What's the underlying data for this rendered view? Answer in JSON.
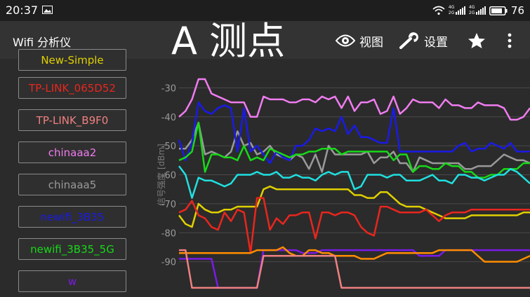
{
  "status_bar": {
    "time": "20:37",
    "signal_label_1": "4G",
    "signal_label_2": "2G",
    "signal_label_3": "4G",
    "signal_label_4": "2G",
    "battery": "76"
  },
  "app_bar": {
    "title": "Wifi 分析仪",
    "overlay_title": "A 测点",
    "view_label": "视图",
    "settings_label": "设置"
  },
  "sidebar": {
    "items": [
      {
        "label": "New-Simple",
        "color": "#e0d000"
      },
      {
        "label": "TP-LINK_065D52",
        "color": "#e8261e"
      },
      {
        "label": "TP-LINK_B9F0",
        "color": "#f08080"
      },
      {
        "label": "chinaaa2",
        "color": "#f07cf0"
      },
      {
        "label": "chinaaa5",
        "color": "#9a9a9a"
      },
      {
        "label": "newifi_3B35",
        "color": "#1a1ae8"
      },
      {
        "label": "newifi_3B35_5G",
        "color": "#18d818"
      },
      {
        "label": "w",
        "color": "#7a1ae8"
      }
    ]
  },
  "chart_data": {
    "type": "line",
    "ylabel": "信号强度 [dBm]",
    "ylim": [
      -100,
      -20
    ],
    "yticks": [
      -30,
      -40,
      -50,
      -60,
      -70,
      -80,
      -90
    ],
    "grid": true,
    "x": [
      0,
      1,
      2,
      3,
      4,
      5,
      6,
      7,
      8,
      9,
      10,
      11,
      12,
      13,
      14,
      15,
      16,
      17,
      18,
      19,
      20,
      21,
      22,
      23,
      24,
      25,
      26,
      27,
      28,
      29,
      30,
      31,
      32,
      33,
      34,
      35,
      36,
      37,
      38,
      39,
      40,
      41,
      42,
      43,
      44,
      45,
      46,
      47,
      48,
      49,
      50,
      51,
      52,
      53,
      54
    ],
    "series": [
      {
        "name": "chinaaa2",
        "color": "#f07cf0",
        "values": [
          -40,
          -38,
          -34,
          -27,
          -27,
          -32,
          -33,
          -34,
          -35,
          -35,
          -35,
          -40,
          -40,
          -33,
          -34,
          -34,
          -34,
          -35,
          -35,
          -34,
          -34,
          -35,
          -33,
          -34,
          -33,
          -37,
          -33,
          -38,
          -35,
          -35,
          -34,
          -39,
          -38,
          -33,
          -39,
          -37,
          -34,
          -35,
          -35,
          -35,
          -37,
          -34,
          -36,
          -36,
          -37,
          -37,
          -35,
          -36,
          -36,
          -36,
          -37,
          -41,
          -41,
          -40,
          -37
        ]
      },
      {
        "name": "chinaaa5",
        "color": "#9a9a9a",
        "values": [
          -51,
          -51,
          -48,
          -42,
          -53,
          -52,
          -53,
          -54,
          -52,
          -45,
          -50,
          -49,
          -53,
          -52,
          -50,
          -53,
          -54,
          -55,
          -53,
          -54,
          -58,
          -53,
          -59,
          -50,
          -53,
          -53,
          -53,
          -53,
          -53,
          -52,
          -56,
          -54,
          -54,
          -52,
          -56,
          -56,
          -59,
          -54,
          -55,
          -56,
          -56,
          -56,
          -56,
          -56,
          -58,
          -58,
          -57,
          -57,
          -57,
          -55,
          -53,
          -54,
          -55,
          -55,
          -56
        ]
      },
      {
        "name": "newifi_3B35",
        "color": "#1a1ae8",
        "values": [
          -48,
          -55,
          -49,
          -35,
          -38,
          -39,
          -37,
          -36,
          -37,
          -52,
          -37,
          -52,
          -50,
          -53,
          -56,
          -52,
          -54,
          -55,
          -50,
          -50,
          -48,
          -44,
          -45,
          -44,
          -45,
          -40,
          -46,
          -43,
          -47,
          -47,
          -48,
          -49,
          -49,
          -37,
          -52,
          -52,
          -52,
          -52,
          -52,
          -52,
          -52,
          -52,
          -52,
          -50,
          -49,
          -52,
          -51,
          -51,
          -49,
          -50,
          -51,
          -49,
          -52,
          -52,
          -52
        ]
      },
      {
        "name": "newifi_3B35_5G",
        "color": "#18d818",
        "values": [
          -55,
          -54,
          -52,
          -42,
          -59,
          -53,
          -53,
          -54,
          -54,
          -55,
          -50,
          -55,
          -54,
          -55,
          -51,
          -52,
          -53,
          -54,
          -53,
          -53,
          -52,
          -52,
          -51,
          -51,
          -51,
          -53,
          -52,
          -52,
          -52,
          -52,
          -52,
          -52,
          -52,
          -55,
          -53,
          -53,
          -59,
          -57,
          -57,
          -58,
          -58,
          -56,
          -57,
          -57,
          -59,
          -59,
          -61,
          -61,
          -60,
          -60,
          -58,
          -58,
          -58,
          -56,
          -56
        ]
      },
      {
        "name": "w",
        "color": "#7a1ae8",
        "values": [
          -89,
          -89,
          -89,
          -89,
          -89,
          -89,
          -99,
          -99,
          -99,
          -99,
          -99,
          -99,
          -99,
          -86,
          -86,
          -86,
          -86,
          -86,
          -86,
          -87,
          -87,
          -87,
          -86,
          -86,
          -86,
          -86,
          -86,
          -86,
          -86,
          -86,
          -86,
          -86,
          -86,
          -86,
          -86,
          -86,
          -86,
          -88,
          -88,
          -88,
          -88,
          -86,
          -86,
          -86,
          -86,
          -86,
          -86,
          -86,
          -86,
          -86,
          -86,
          -86,
          -86,
          -86,
          -86
        ]
      },
      {
        "name": "newifi_3B35",
        "color": "#20e0e0",
        "values": [
          -57,
          -60,
          -68,
          -61,
          -62,
          -62,
          -63,
          -64,
          -63,
          -60,
          -60,
          -60,
          -59,
          -60,
          -60,
          -59,
          -61,
          -61,
          -60,
          -61,
          -61,
          -62,
          -60,
          -59,
          -60,
          -59,
          -59,
          -65,
          -64,
          -60,
          -60,
          -60,
          -61,
          -60,
          -60,
          -62,
          -62,
          -62,
          -61,
          -60,
          -62,
          -62,
          -63,
          -60,
          -60,
          -61,
          -61,
          -62,
          -61,
          -60,
          -60,
          -58,
          -59,
          -61,
          -63
        ]
      },
      {
        "name": "New-Simple",
        "color": "#e0d000",
        "values": [
          -74,
          -77,
          -78,
          -70,
          -72,
          -73,
          -73,
          -72,
          -72,
          -71,
          -71,
          -71,
          -71,
          -65,
          -64,
          -65,
          -65,
          -65,
          -65,
          -65,
          -65,
          -65,
          -65,
          -65,
          -65,
          -65,
          -65,
          -67,
          -67,
          -68,
          -68,
          -66,
          -66,
          -68,
          -70,
          -71,
          -71,
          -71,
          -72,
          -73,
          -74,
          -75,
          -75,
          -75,
          -75,
          -74,
          -74,
          -74,
          -74,
          -74,
          -74,
          -74,
          -74,
          -73,
          -73
        ]
      },
      {
        "name": "TP-LINK_065D52",
        "color": "#e8261e",
        "values": [
          -73,
          -72,
          -69,
          -74,
          -75,
          -78,
          -79,
          -73,
          -76,
          -72,
          -73,
          -87,
          -68,
          -68,
          -79,
          -75,
          -77,
          -74,
          -74,
          -73,
          -73,
          -82,
          -73,
          -73,
          -74,
          -73,
          -73,
          -74,
          -78,
          -80,
          -81,
          -71,
          -71,
          -72,
          -73,
          -73,
          -73,
          -73,
          -72,
          -74,
          -76,
          -74,
          -73,
          -73,
          -73,
          -72,
          -72,
          -72,
          -72,
          -72,
          -72,
          -72,
          -72,
          -72,
          -72
        ]
      },
      {
        "name": "TP-LINK_065D52",
        "color": "#ff8c00",
        "values": [
          -87,
          -87,
          -87,
          -87,
          -87,
          -87,
          -87,
          -87,
          -87,
          -87,
          -87,
          -87,
          -86,
          -86,
          -86,
          -86,
          -85,
          -87,
          -88,
          -88,
          -86,
          -86,
          -87,
          -87,
          -88,
          -88,
          -88,
          -88,
          -89,
          -89,
          -89,
          -88,
          -87,
          -87,
          -87,
          -87,
          -87,
          -87,
          -87,
          -87,
          -86,
          -86,
          -86,
          -86,
          -86,
          -86,
          -88,
          -90,
          -90,
          -90,
          -90,
          -90,
          -90,
          -89,
          -88
        ]
      },
      {
        "name": "TP-LINK_B9F0",
        "color": "#f08080",
        "values": [
          -86,
          -86,
          -99,
          -99,
          -99,
          -99,
          -99,
          -99,
          -99,
          -99,
          -99,
          -99,
          -99,
          -88,
          -88,
          -88,
          -88,
          -88,
          -88,
          -88,
          -88,
          -88,
          -88,
          -88,
          -88,
          -99,
          -99,
          -99,
          -99,
          -99,
          -99,
          -99,
          -99,
          -99,
          -99,
          -99,
          -99,
          -99,
          -99,
          -99,
          -99,
          -99,
          -99,
          -99,
          -99,
          -99,
          -99,
          -99,
          -99,
          -99,
          -99,
          -99,
          -99,
          -99,
          -99
        ]
      }
    ]
  }
}
